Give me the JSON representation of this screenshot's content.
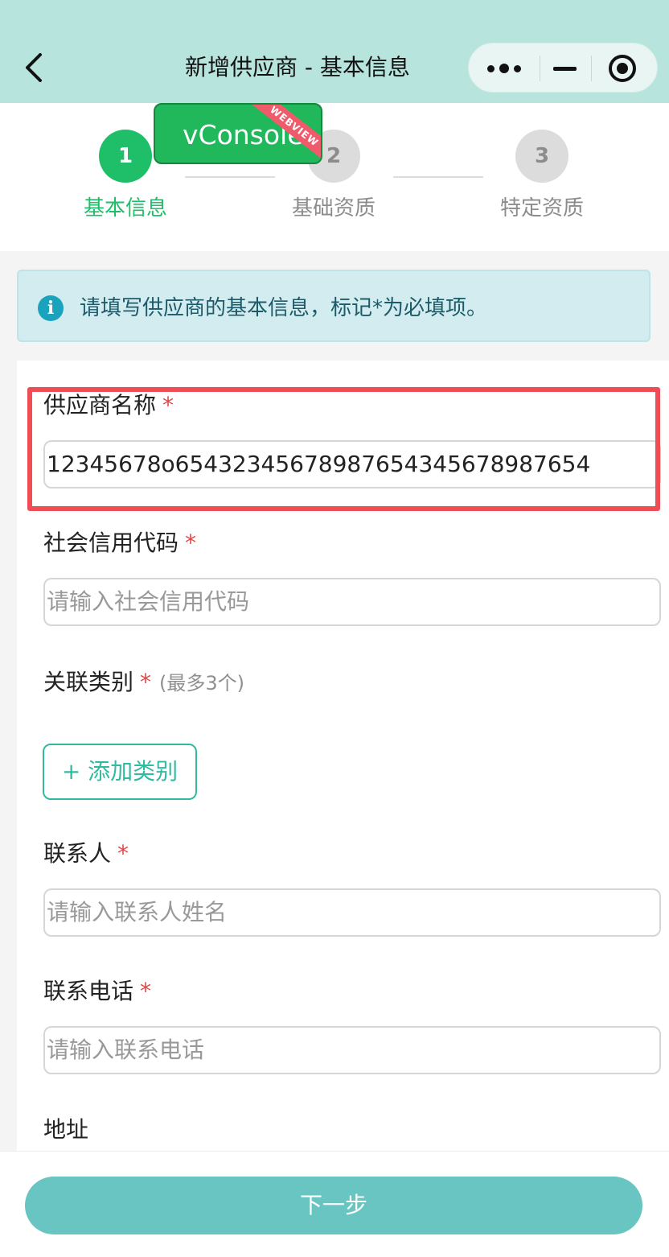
{
  "header": {
    "title": "新增供应商 - 基本信息",
    "back_icon": "chevron-left-icon",
    "capsule": {
      "more_icon": "more-dots-icon",
      "minimize_icon": "minimize-icon",
      "close_icon": "target-circle-icon"
    },
    "background_color": "#b7e4dd"
  },
  "vconsole": {
    "label": "vConsole",
    "ribbon": "WEBVIEW"
  },
  "steps": [
    {
      "number": "1",
      "label": "基本信息",
      "state": "active"
    },
    {
      "number": "2",
      "label": "基础资质",
      "state": "inactive"
    },
    {
      "number": "3",
      "label": "特定资质",
      "state": "inactive"
    }
  ],
  "notice": {
    "icon": "info-icon",
    "text": "请填写供应商的基本信息，标记*为必填项。"
  },
  "form": {
    "supplier_name": {
      "label": "供应商名称",
      "required": "*",
      "value": "12345678o654323456789876543456789876​54"
    },
    "credit_code": {
      "label": "社会信用代码",
      "required": "*",
      "placeholder": "请输入社会信用代码"
    },
    "category": {
      "label": "关联类别",
      "required": "*",
      "hint": "(最多3个)",
      "add_button": "+ 添加类别"
    },
    "contact": {
      "label": "联系人",
      "required": "*",
      "placeholder": "请输入联系人姓名"
    },
    "phone": {
      "label": "联系电话",
      "required": "*",
      "placeholder": "请输入联系电话"
    },
    "address": {
      "label": "地址"
    }
  },
  "footer": {
    "next_label": "下一步"
  },
  "colors": {
    "primary_green": "#1fbf6a",
    "teal": "#30bba0",
    "button": "#68c5c2",
    "required": "#e2474a",
    "highlight": "#ef4d55"
  }
}
